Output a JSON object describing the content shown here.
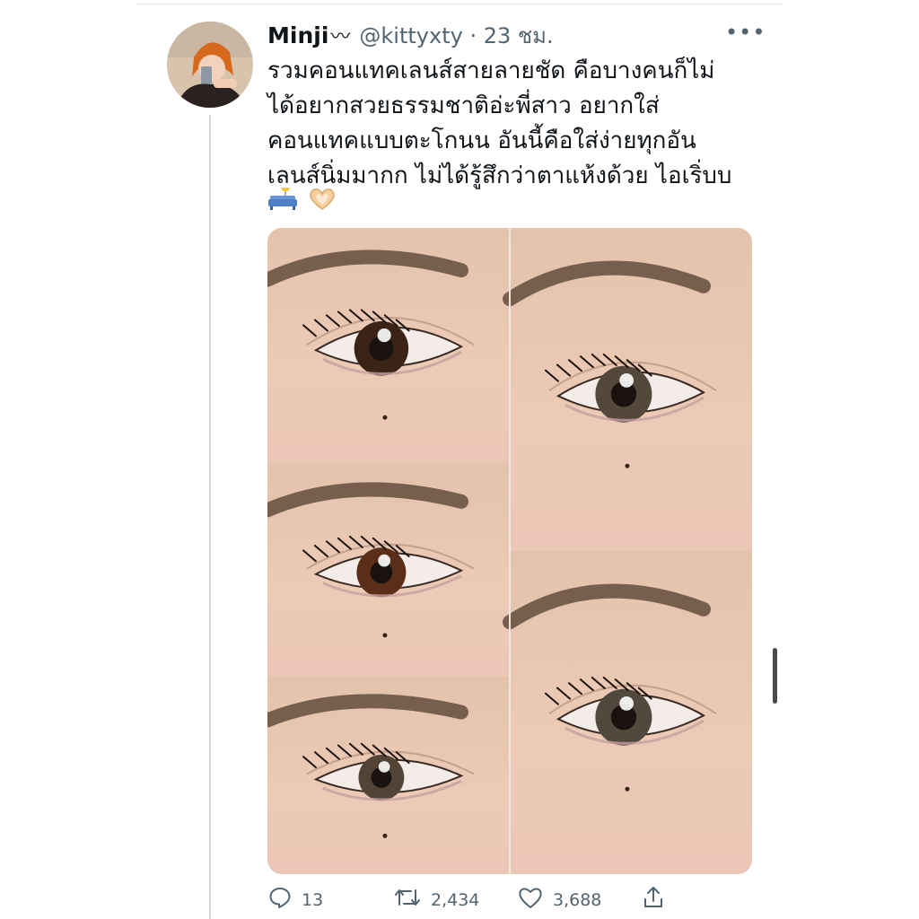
{
  "tweet": {
    "author_name": "Minji",
    "handle_and_time": "@kittyxty · 23 ชม.",
    "text": "รวมคอนแทคเลนส์สายลายชัด คือบางคนก็ไม่\nได้อยากสวยธรรมชาติอ่ะพี่สาว อยากใส่\nคอนแทคแบบตะโกนน อันนี้คือใส่ง่ายทุกอัน\nเลนส์นิ่มมากก ไม่ได้รู้สึกว่าตาแห้งด้วย ไอเริ่บบ",
    "emojis": [
      "couch-and-lamp",
      "heart-hands"
    ],
    "media": {
      "photos": [
        {
          "iris_color": "#3b2416"
        },
        {
          "iris_color": "#54483c"
        },
        {
          "iris_color": "#5a2e18"
        },
        {
          "iris_color": "#52493e"
        },
        {
          "iris_color": "#514436"
        }
      ]
    }
  },
  "actions": {
    "replies": "13",
    "retweets": "2,434",
    "likes": "3,688"
  }
}
